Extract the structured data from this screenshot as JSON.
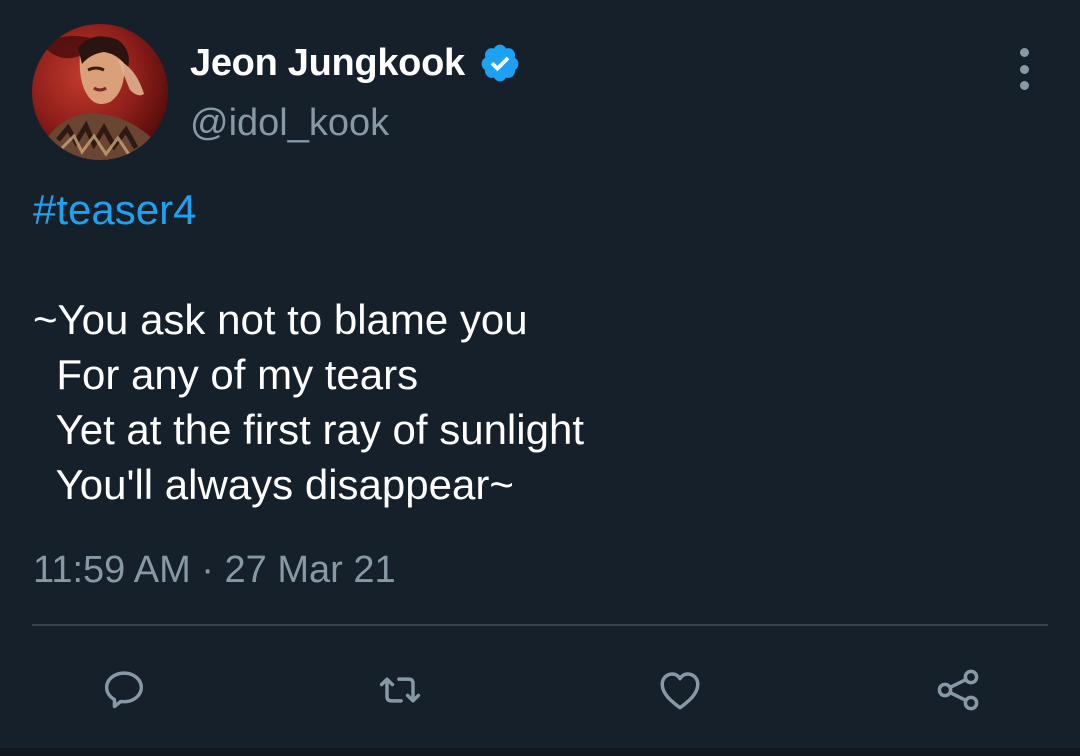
{
  "tweet": {
    "author": {
      "display_name": "Jeon Jungkook",
      "handle": "@idol_kook",
      "verified": true
    },
    "hashtag": "#teaser4",
    "poem_lines": [
      "~You ask not to blame you",
      "  For any of my tears",
      "  Yet at the first ray of sunlight",
      "  You'll always disappear~"
    ],
    "timestamp": "11:59 AM · 27 Mar 21",
    "actions": {
      "reply_icon": "reply-icon",
      "retweet_icon": "retweet-icon",
      "like_icon": "like-icon",
      "share_icon": "share-icon"
    }
  },
  "theme": {
    "background": "#15202b",
    "accent": "#1da1f2",
    "secondary_text": "#8899a6",
    "divider": "#38444d"
  }
}
